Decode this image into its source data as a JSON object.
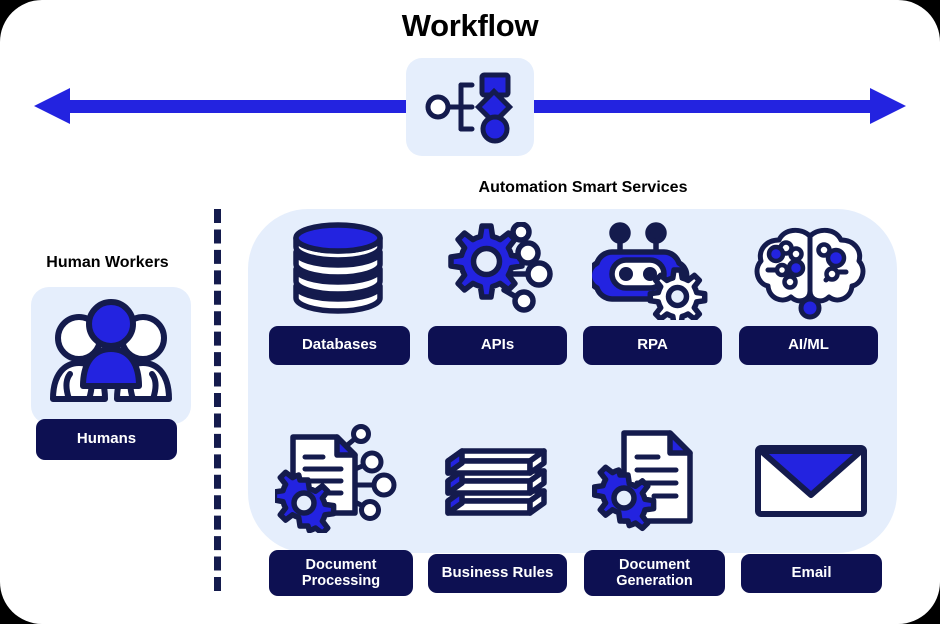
{
  "diagram": {
    "title": "Workflow",
    "center_icon": "workflow-flowchart-icon",
    "axis_arrow": "double-headed-arrow"
  },
  "sections": {
    "human": {
      "heading": "Human Workers",
      "card": {
        "icon": "people-group-icon",
        "label": "Humans"
      }
    },
    "automation": {
      "heading": "Automation Smart Services",
      "items": [
        {
          "label": "Databases",
          "icon": "database-cylinder-icon"
        },
        {
          "label": "APIs",
          "icon": "gear-network-icon"
        },
        {
          "label": "RPA",
          "icon": "robot-gear-icon"
        },
        {
          "label": "AI/ML",
          "icon": "brain-circuit-icon"
        },
        {
          "label": "Document Processing",
          "icon": "document-gear-network-icon"
        },
        {
          "label": "Business Rules",
          "icon": "book-stack-icon"
        },
        {
          "label": "Document Generation",
          "icon": "document-gear-icon"
        },
        {
          "label": "Email",
          "icon": "envelope-icon"
        }
      ]
    }
  },
  "colors": {
    "background": "#000000",
    "card": "#ffffff",
    "panel": "#e5eefc",
    "accent_blue": "#2323e0",
    "navy": "#0d1052",
    "outline": "#141b4d",
    "white": "#ffffff"
  }
}
